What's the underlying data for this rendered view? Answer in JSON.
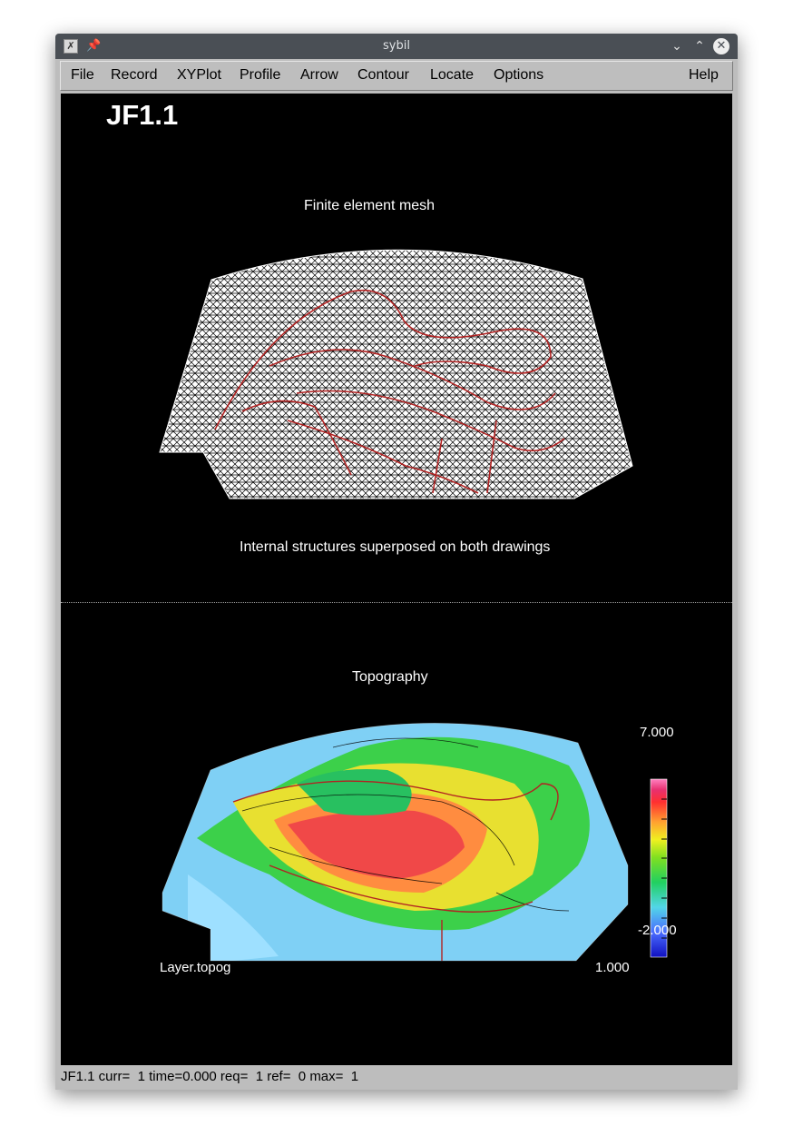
{
  "window": {
    "title": "sybil",
    "icons": [
      "app-icon",
      "pin-icon",
      "minimize-icon",
      "maximize-icon",
      "close-icon"
    ]
  },
  "menu": {
    "file": "File",
    "record": "Record",
    "xyplot": "XYPlot",
    "profile": "Profile",
    "arrow": "Arrow",
    "contour": "Contour",
    "locate": "Locate",
    "options": "Options",
    "help": "Help"
  },
  "canvas": {
    "model_name": "JF1.1",
    "mesh_title": "Finite element mesh",
    "caption": "Internal structures superposed on both drawings",
    "topo_title": "Topography",
    "layer_label": "Layer.topog",
    "scale_value": "1.000",
    "colorbar": {
      "max_label": "7.000",
      "min_label": "-2.000"
    }
  },
  "status": {
    "text": "JF1.1 curr=  1 time=0.000 req=  1 ref=  0 max=  1"
  },
  "colors": {
    "canvas_bg": "#000000",
    "mesh": "#ffffff",
    "structure_lines": "#b22222",
    "chrome": "#bdbdbd",
    "titlebar": "#4a4f55"
  }
}
